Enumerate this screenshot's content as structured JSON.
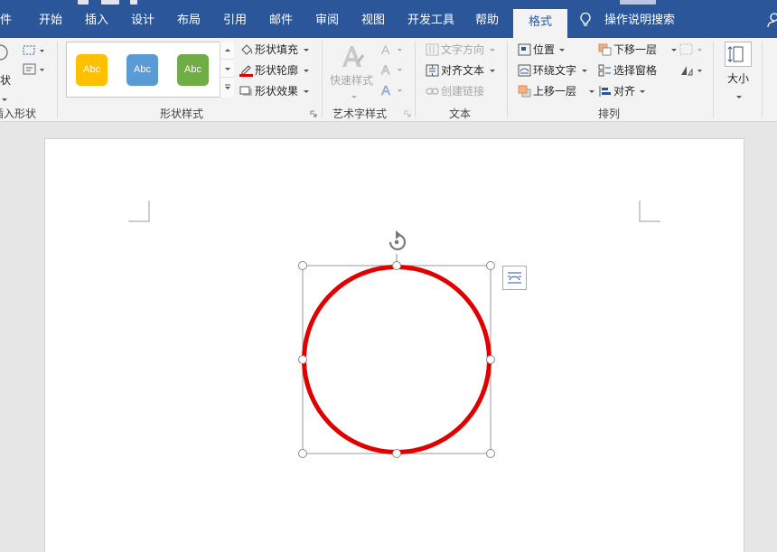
{
  "tabs": {
    "file": "件",
    "home": "开始",
    "insert": "插入",
    "design": "设计",
    "layout": "布局",
    "references": "引用",
    "mailings": "邮件",
    "review": "审阅",
    "view": "视图",
    "developer": "开发工具",
    "help": "帮助",
    "format": "格式",
    "tell_me": "操作说明搜索"
  },
  "ribbon": {
    "insert_shapes": {
      "shapes_label": "状",
      "group_label": "插入形状"
    },
    "shape_styles": {
      "swatches": [
        {
          "label": "Abc",
          "color": "#ffc000"
        },
        {
          "label": "Abc",
          "color": "#5b9bd5"
        },
        {
          "label": "Abc",
          "color": "#70ad47"
        }
      ],
      "fill": "形状填充",
      "outline": "形状轮廓",
      "effects": "形状效果",
      "group_label": "形状样式"
    },
    "wordart": {
      "quick_styles": "快速样式",
      "group_label": "艺术字样式"
    },
    "text": {
      "direction": "文字方向",
      "align_text": "对齐文本",
      "create_link": "创建链接",
      "group_label": "文本"
    },
    "arrange": {
      "position": "位置",
      "wrap_text": "环绕文字",
      "bring_forward": "上移一层",
      "send_backward": "下移一层",
      "selection_pane": "选择窗格",
      "align": "对齐",
      "group_label": "排列"
    },
    "size": {
      "label": "大小"
    }
  },
  "colors": {
    "title_bar": "#2b579a",
    "circle_stroke": "#e00000",
    "outline_red": "#e00000"
  },
  "icons": [
    "lightbulb-icon",
    "person-icon",
    "rotate-handle-icon",
    "layout-options-icon"
  ]
}
